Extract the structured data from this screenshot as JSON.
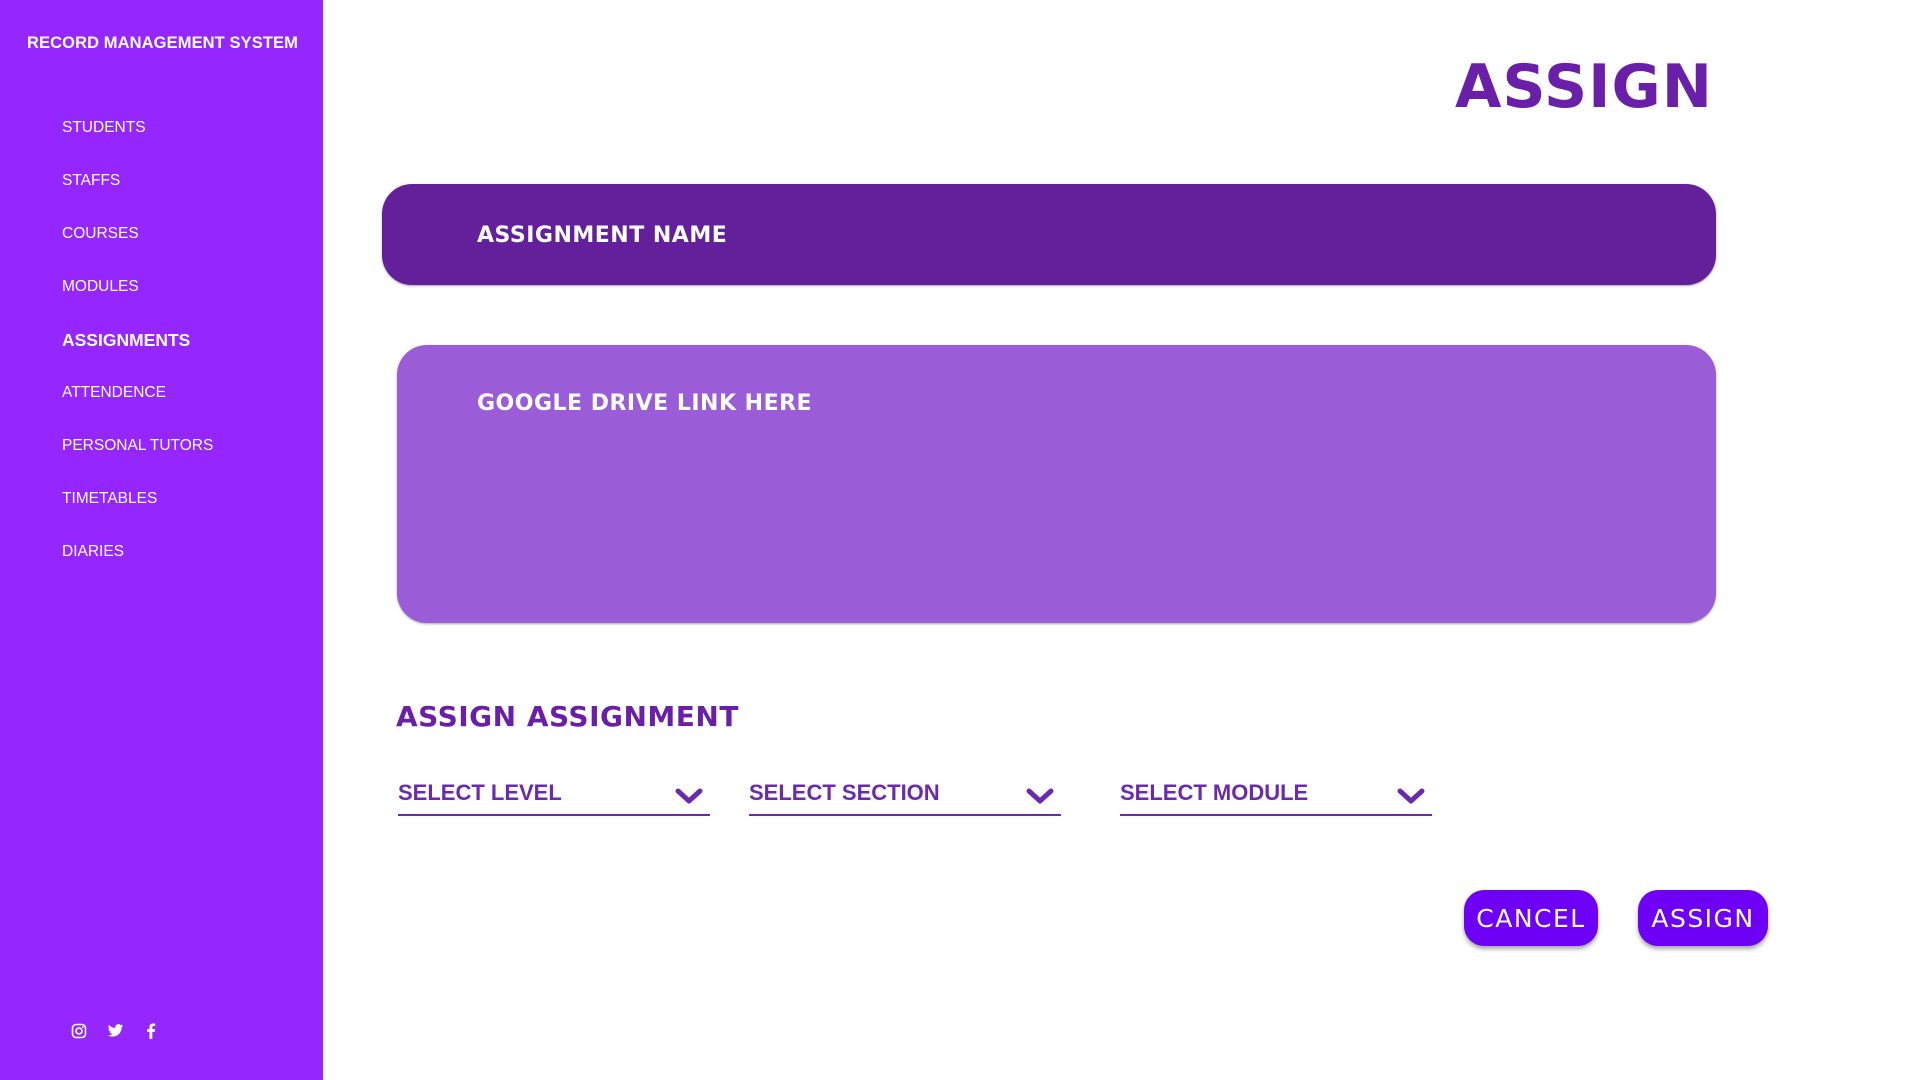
{
  "app": {
    "title": "RECORD MANAGEMENT SYSTEM"
  },
  "sidebar": {
    "items": [
      {
        "label": "STUDENTS"
      },
      {
        "label": "STAFFS"
      },
      {
        "label": "COURSES"
      },
      {
        "label": "MODULES"
      },
      {
        "label": "ASSIGNMENTS",
        "active": true
      },
      {
        "label": "ATTENDENCE"
      },
      {
        "label": "PERSONAL TUTORS"
      },
      {
        "label": "TIMETABLES"
      },
      {
        "label": "DIARIES"
      }
    ],
    "social_icons": [
      "instagram-icon",
      "twitter-icon",
      "facebook-icon"
    ]
  },
  "main": {
    "title": "ASSIGN",
    "assignment_name_placeholder": "ASSIGNMENT NAME",
    "drive_link_placeholder": "GOOGLE DRIVE LINK HERE",
    "section_heading": "ASSIGN ASSIGNMENT",
    "selects": {
      "level": "SELECT LEVEL",
      "section": "SELECT SECTION",
      "module": "SELECT MODULE"
    },
    "buttons": {
      "cancel": "CANCEL",
      "assign": "ASSIGN"
    }
  },
  "colors": {
    "sidebar": "#9526FD",
    "name_field": "#63209A",
    "link_field": "#9B5CD8",
    "heading": "#6A1FA9",
    "button": "#6E00F5"
  }
}
